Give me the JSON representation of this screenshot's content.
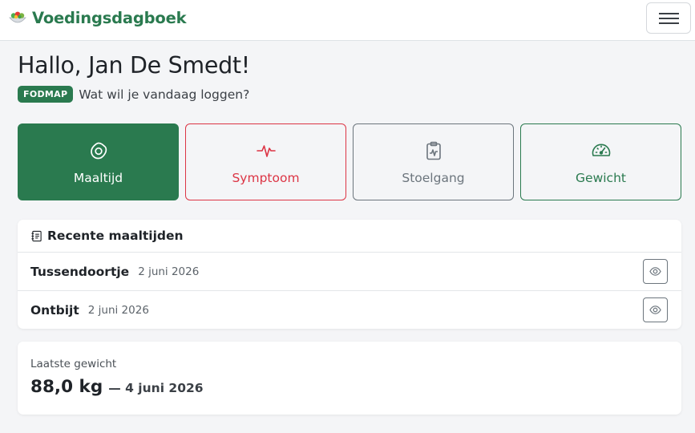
{
  "navbar": {
    "brand": "Voedingsdagboek",
    "brand_icon": "salad-icon"
  },
  "greeting": {
    "title": "Hallo, Jan De Smedt!",
    "badge": "FODMAP",
    "prompt": "Wat wil je vandaag loggen?"
  },
  "actions": [
    {
      "label": "Maaltijd",
      "icon": "egg-icon",
      "color": "#2a7a4f",
      "style": "filled"
    },
    {
      "label": "Symptoom",
      "icon": "pulse-icon",
      "color": "#dc3545",
      "style": "outline"
    },
    {
      "label": "Stoelgang",
      "icon": "clipboard-pulse-icon",
      "color": "#6c757d",
      "style": "outline"
    },
    {
      "label": "Gewicht",
      "icon": "speedometer-icon",
      "color": "#2a7a4f",
      "style": "outline"
    }
  ],
  "recent_meals": {
    "title": "Recente maaltijden",
    "icon": "journal-text-icon",
    "items": [
      {
        "name": "Tussendoortje",
        "date": "2 juni 2026"
      },
      {
        "name": "Ontbijt",
        "date": "2 juni 2026"
      }
    ]
  },
  "latest_weight": {
    "label": "Laatste gewicht",
    "value": "88,0 kg",
    "date": "— 4 juni 2026"
  }
}
